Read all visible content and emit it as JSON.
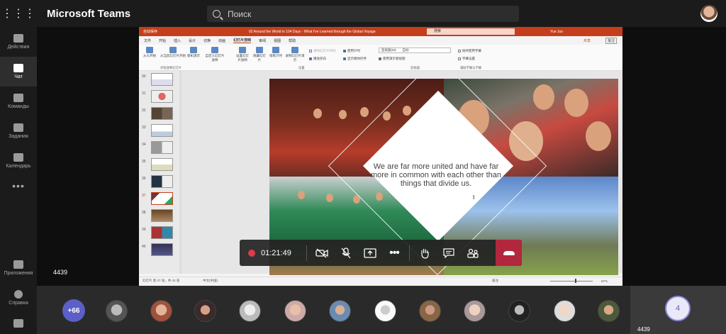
{
  "app": {
    "title": "Microsoft Teams"
  },
  "search": {
    "placeholder": "Поиск"
  },
  "rail": {
    "items": [
      {
        "label": "Действия"
      },
      {
        "label": "Чат"
      },
      {
        "label": "Команды"
      },
      {
        "label": "Задания"
      },
      {
        "label": "Календарь"
      }
    ],
    "more": "•••",
    "bottom": [
      {
        "label": "Приложения"
      },
      {
        "label": "Справка"
      }
    ]
  },
  "stage": {
    "participant_label": "4439"
  },
  "powerpoint": {
    "titlebar": {
      "autosave": "自动保存",
      "doc_title": "02 Around the World in 104 Days - What I've Learned through the Global Voyage",
      "search": "搜索",
      "user": "Yue Jun"
    },
    "tabs": [
      "文件",
      "开始",
      "插入",
      "设计",
      "切换",
      "动画",
      "幻灯片放映",
      "审阅",
      "视图",
      "帮助"
    ],
    "active_tab": "幻灯片放映",
    "share": "共享",
    "comments": "批注",
    "ribbon": {
      "btn1": "从头开始",
      "btn2": "从当前幻灯片开始",
      "btn3": "联机演示",
      "btn4": "自定义幻灯片放映",
      "group1": "开始放映幻灯片",
      "btn5": "设置幻灯片放映",
      "btn6": "隐藏幻灯片",
      "btn7": "排练计时",
      "btn8": "录制幻灯片演示",
      "chk1": "播放旁白",
      "chk2": "使用计时",
      "chk3": "显示媒体控件",
      "chk0": "清除幻灯片时间",
      "group2": "设置",
      "monitor_label": "监视器(M):",
      "monitor_value": "自动",
      "chk4": "使用演示者视图",
      "group3": "监视器",
      "chk5": "始终使用字幕",
      "btn9": "字幕设置",
      "group4": "辅助字幕与字幕"
    },
    "thumbs": [
      "30",
      "31",
      "32",
      "33",
      "34",
      "35",
      "36",
      "37",
      "38",
      "39",
      "40"
    ],
    "active_thumb": "37",
    "slide": {
      "quote": "We are far more united and have far more in common with each other than things that divide us."
    },
    "status": {
      "left": "幻灯片 第 37 张，共 43 张",
      "lang": "中文(中国)",
      "notes": "备注",
      "zoom": "87%"
    }
  },
  "call_controls": {
    "timer": "01:21:49"
  },
  "gallery": {
    "overflow": "+66",
    "self_initial": "4",
    "self_label": "4439"
  }
}
